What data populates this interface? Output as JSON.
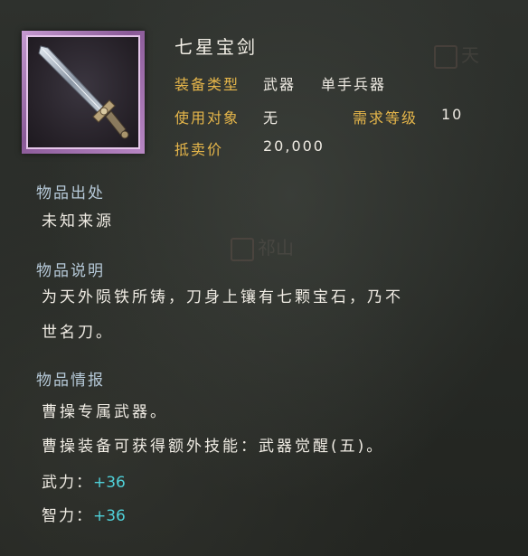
{
  "item": {
    "name": "七星宝剑",
    "equip_type_label": "装备类型",
    "equip_type_value": "武器",
    "equip_subtype_value": "单手兵器",
    "user_label": "使用对象",
    "user_value": "无",
    "req_level_label": "需求等级",
    "req_level_value": "10",
    "price_label": "抵卖价",
    "price_value": "20,000",
    "frame_color": "#b887c4"
  },
  "sections": {
    "origin_title": "物品出处",
    "origin_text": "未知来源",
    "desc_title": "物品说明",
    "desc_line1": "为天外陨铁所铸，刀身上镶有七颗宝石，乃不",
    "desc_line2": "世名刀。",
    "intel_title": "物品情报",
    "intel_line1": "曹操专属武器。",
    "intel_line2": "曹操装备可获得额外技能：武器觉醒(五)。"
  },
  "stats": [
    {
      "label": "武力：",
      "value": "+36"
    },
    {
      "label": "智力：",
      "value": "+36"
    }
  ],
  "background_marks": [
    "天",
    "祁山"
  ],
  "icons": [
    "sword-icon"
  ]
}
